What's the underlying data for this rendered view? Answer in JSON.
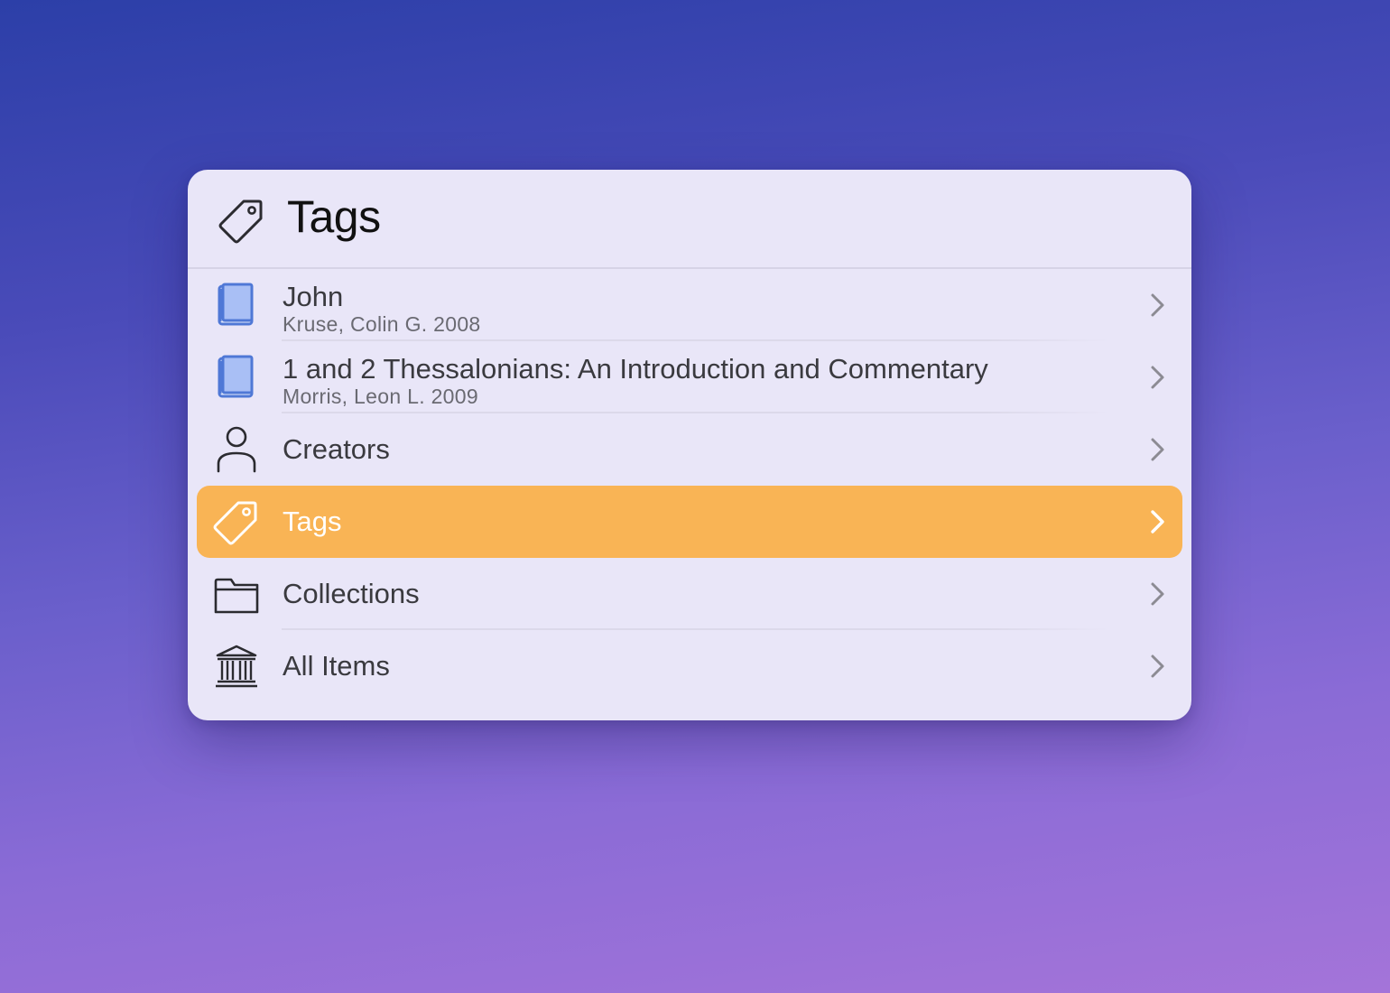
{
  "header": {
    "title": "Tags",
    "icon": "tag-icon"
  },
  "rows": [
    {
      "title": "John",
      "subtitle": "Kruse, Colin G. 2008",
      "icon": "book-icon",
      "selected": false
    },
    {
      "title": "1 and 2 Thessalonians: An Introduction and Commentary",
      "subtitle": "Morris, Leon L. 2009",
      "icon": "book-icon",
      "selected": false
    },
    {
      "title": "Creators",
      "icon": "person-icon",
      "selected": false
    },
    {
      "title": "Tags",
      "icon": "tag-icon",
      "selected": true
    },
    {
      "title": "Collections",
      "icon": "folder-icon",
      "selected": false
    },
    {
      "title": "All Items",
      "icon": "library-icon",
      "selected": false
    }
  ],
  "colors": {
    "selection": "#f9b455",
    "book_blue": "#4f78d6",
    "panel_bg": "#e9e6f8"
  }
}
